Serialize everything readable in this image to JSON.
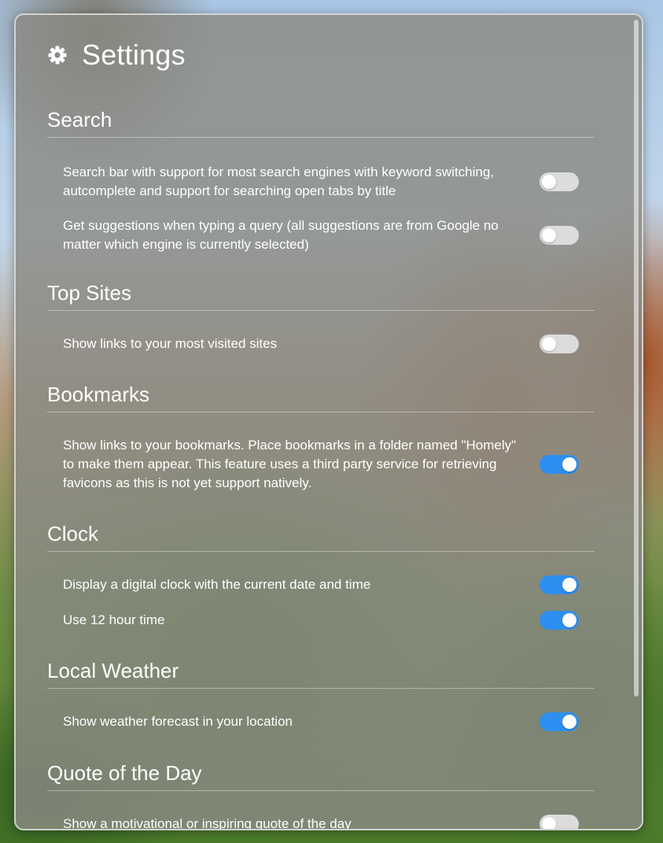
{
  "header": {
    "title": "Settings",
    "icon": "gear-icon"
  },
  "colors": {
    "toggle_on": "#2d8fef",
    "toggle_off": "#dcdcdc"
  },
  "sections": [
    {
      "title": "Search",
      "items": [
        {
          "label": "Search bar with support for most search engines with keyword switching, autcomplete and support for searching open tabs by title",
          "enabled": false
        },
        {
          "label": "Get suggestions when typing a query (all suggestions are from Google no matter which engine is currently selected)",
          "enabled": false
        }
      ]
    },
    {
      "title": "Top Sites",
      "items": [
        {
          "label": "Show links to your most visited sites",
          "enabled": false
        }
      ]
    },
    {
      "title": "Bookmarks",
      "items": [
        {
          "label": "Show links to your bookmarks. Place bookmarks in a folder named \"Homely\" to make them appear. This feature uses a third party service for retrieving favicons as this is not yet support natively.",
          "enabled": true
        }
      ]
    },
    {
      "title": "Clock",
      "items": [
        {
          "label": "Display a digital clock with the current date and time",
          "enabled": true
        },
        {
          "label": "Use 12 hour time",
          "enabled": true
        }
      ]
    },
    {
      "title": "Local Weather",
      "items": [
        {
          "label": "Show weather forecast in your location",
          "enabled": true
        }
      ]
    },
    {
      "title": "Quote of the Day",
      "items": [
        {
          "label": "Show a motivational or inspiring quote of the day",
          "enabled": false
        }
      ]
    }
  ]
}
